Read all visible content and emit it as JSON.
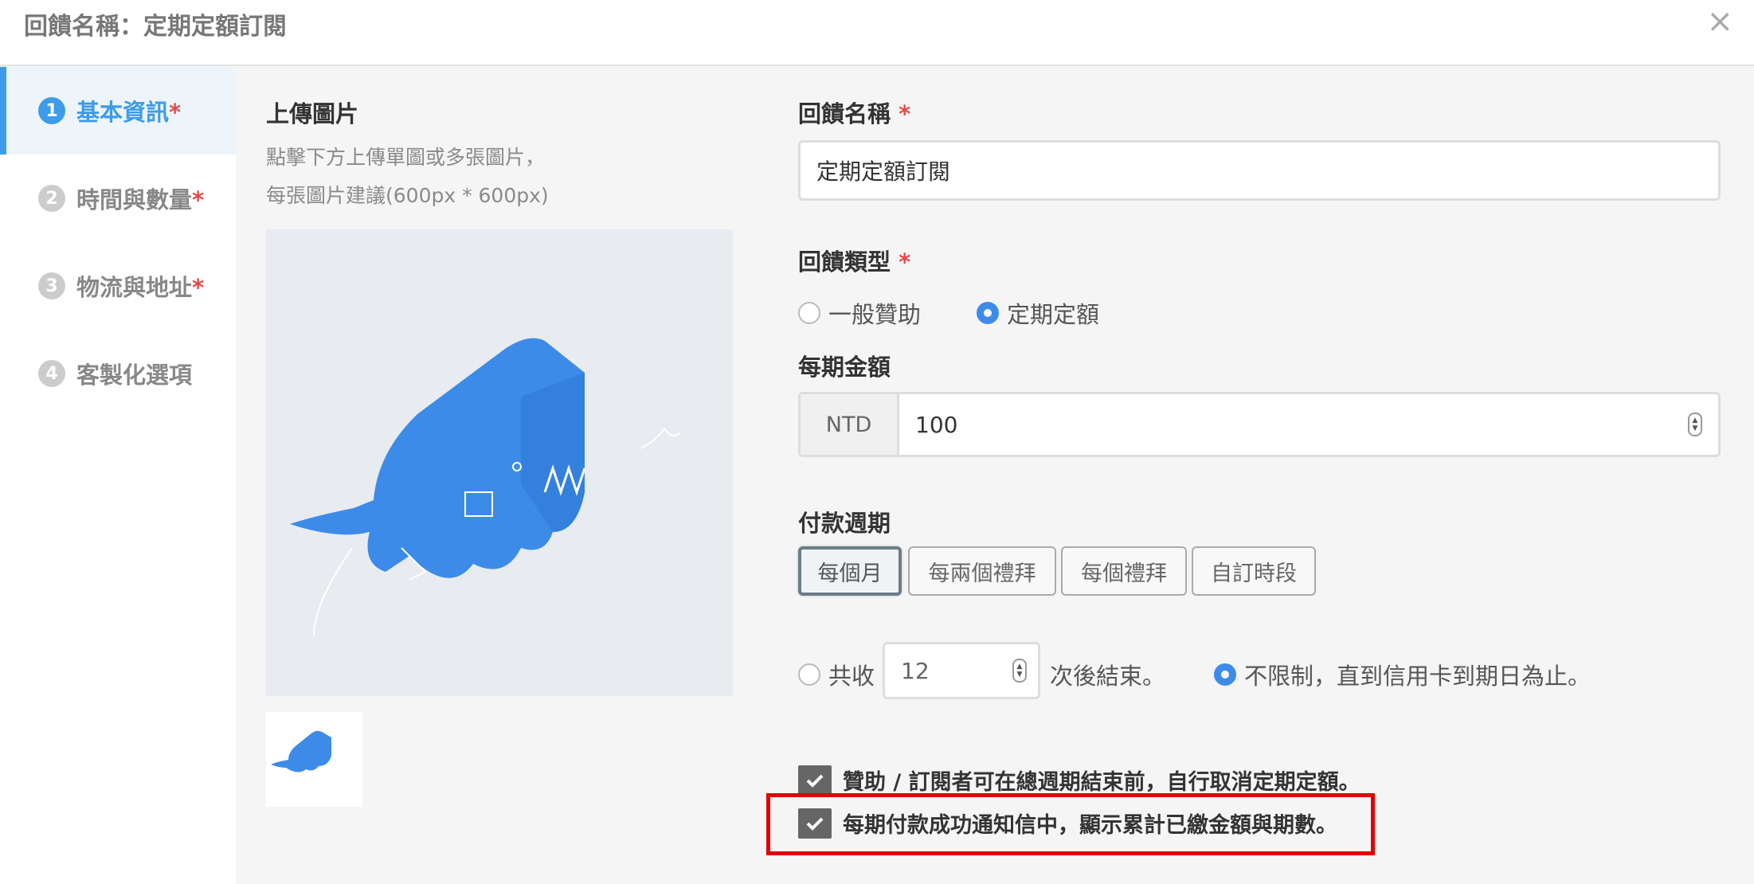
{
  "header": {
    "title": "回饋名稱：定期定額訂閱",
    "close_label": "×"
  },
  "steps": [
    {
      "num": "1",
      "label": "基本資訊",
      "required": "*",
      "active": true
    },
    {
      "num": "2",
      "label": "時間與數量",
      "required": "*",
      "active": false
    },
    {
      "num": "3",
      "label": "物流與地址",
      "required": "*",
      "active": false
    },
    {
      "num": "4",
      "label": "客製化選項",
      "required": "",
      "active": false
    }
  ],
  "upload": {
    "title": "上傳圖片",
    "hint1": "點擊下方上傳單圖或多張圖片，",
    "hint2": "每張圖片建議(600px * 600px)",
    "image_icon": "whale-illustration",
    "accent": "#3d8be9"
  },
  "form": {
    "name_label": "回饋名稱",
    "name_value": "定期定額訂閱",
    "type_label": "回饋類型",
    "type_options": [
      "一般贊助",
      "定期定額"
    ],
    "type_selected": "定期定額",
    "amount_label": "每期金額",
    "currency": "NTD",
    "amount_value": "100",
    "cycle_label": "付款週期",
    "cycle_options": [
      "每個月",
      "每兩個禮拜",
      "每個禮拜",
      "自訂時段"
    ],
    "cycle_selected": "每個月",
    "end_prefix": "共收",
    "end_count": "12",
    "end_suffix": "次後結束。",
    "unlimited_label": "不限制，直到信用卡到期日為止。",
    "check1": "贊助 / 訂閱者可在總週期結束前，自行取消定期定額。",
    "check2": "每期付款成功通知信中，顯示累計已繳金額與期數。",
    "required_mark": "*"
  }
}
